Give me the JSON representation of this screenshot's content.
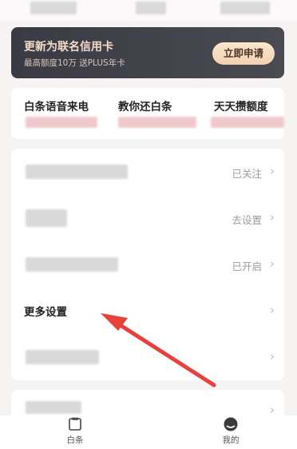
{
  "banner": {
    "title": "更新为联名信用卡",
    "subtitle": "最高额度10万 送PLUS年卡",
    "apply_label": "立即申请"
  },
  "features": [
    {
      "label": "白条语音来电"
    },
    {
      "label": "教你还白条"
    },
    {
      "label": "天天攒额度"
    }
  ],
  "settings": {
    "rows": [
      {
        "status": "已关注"
      },
      {
        "status": "去设置"
      },
      {
        "status": "已开启"
      },
      {
        "label": "更多设置"
      },
      {
        "status": ""
      }
    ]
  },
  "bottom_nav": {
    "tabs": [
      {
        "label": "白条",
        "icon": "baitiao-icon"
      },
      {
        "label": "我的",
        "icon": "profile-icon"
      }
    ]
  },
  "annotation": {
    "color": "#e8413c"
  }
}
